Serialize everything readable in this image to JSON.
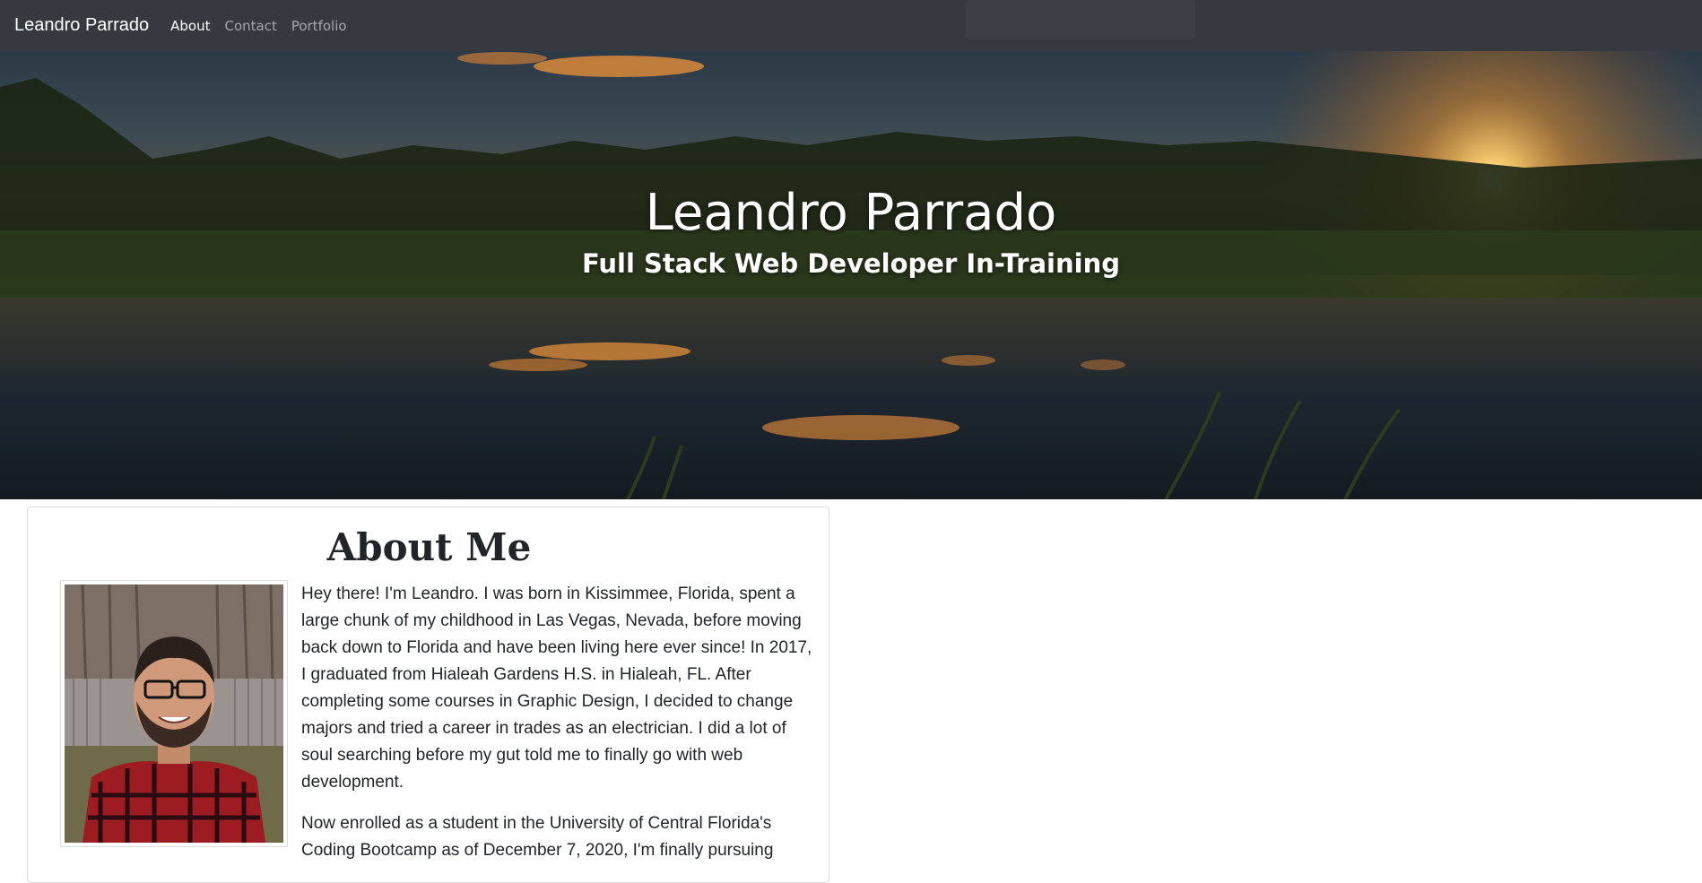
{
  "navbar": {
    "brand": "Leandro Parrado",
    "links": [
      {
        "label": "About",
        "active": true
      },
      {
        "label": "Contact",
        "active": false
      },
      {
        "label": "Portfolio",
        "active": false
      }
    ]
  },
  "hero": {
    "title": "Leandro Parrado",
    "subtitle": "Full Stack Web Developer In-Training"
  },
  "about": {
    "heading": "About Me",
    "paragraphs": [
      "Hey there! I'm Leandro. I was born in Kissimmee, Florida, spent a large chunk of my childhood in Las Vegas, Nevada, before moving back down to Florida and have been living here ever since! In 2017, I graduated from Hialeah Gardens H.S. in Hialeah, FL. After completing some courses in Graphic Design, I decided to change majors and tried a career in trades as an electrician. I did a lot of soul searching before my gut told me to finally go with web development.",
      "Now enrolled as a student in the University of Central Florida's Coding Bootcamp as of December 7, 2020, I'm finally pursuing"
    ]
  },
  "colors": {
    "navbar_bg": "#343a40",
    "nav_active": "#ffffff",
    "nav_inactive": "#9a9da0",
    "text": "#212529"
  }
}
